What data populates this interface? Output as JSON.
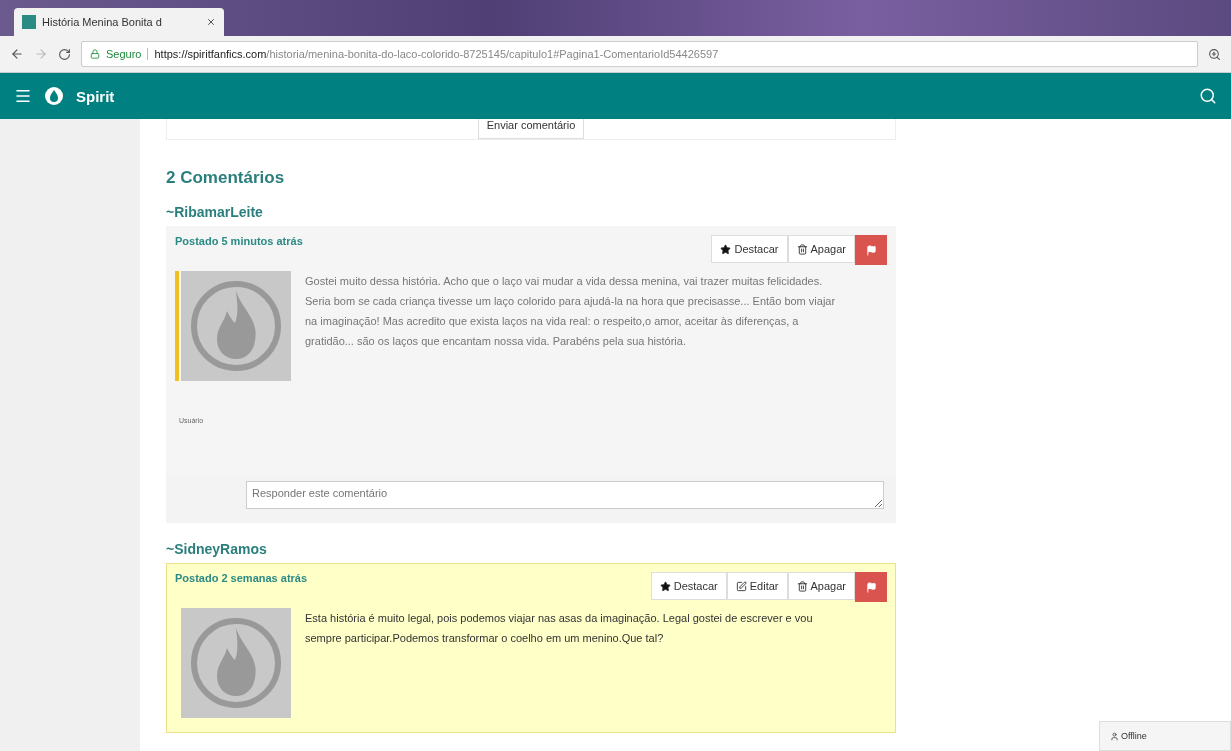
{
  "browser": {
    "tab_title": "História Menina Bonita d",
    "secure_label": "Seguro",
    "url_host": "https://spiritfanfics.com",
    "url_path": "/historia/menina-bonita-do-laco-colorido-8725145/capitulo1#Pagina1-ComentarioId54426597"
  },
  "navbar": {
    "brand": "Spirit"
  },
  "top_card": {
    "button": "Enviar comentário"
  },
  "comments_heading": "2 Comentários",
  "comments": [
    {
      "author": "~RibamarLeite",
      "posted": "Postado 5 minutos atrás",
      "highlighted": false,
      "marked": true,
      "buttons": [
        {
          "kind": "star",
          "label": "Destacar"
        },
        {
          "kind": "trash",
          "label": "Apagar"
        },
        {
          "kind": "flag"
        }
      ],
      "text": "Gostei muito dessa história. Acho que o laço vai mudar a vida dessa menina, vai trazer muitas felicidades. Seria bom se cada criança tivesse um laço colorido para ajudá-la na hora que precisasse... Então bom viajar na imaginação! Mas acredito que exista laços na vida real: o respeito,o amor, aceitar às diferenças, a gratidão... são os laços que encantam nossa vida. Parabéns pela sua história.",
      "role": "Usuário",
      "reply_placeholder": "Responder este comentário"
    },
    {
      "author": "~SidneyRamos",
      "posted": "Postado 2 semanas atrás",
      "highlighted": true,
      "marked": false,
      "buttons": [
        {
          "kind": "star",
          "label": "Destacar"
        },
        {
          "kind": "edit",
          "label": "Editar"
        },
        {
          "kind": "trash",
          "label": "Apagar"
        },
        {
          "kind": "flag"
        }
      ],
      "text": "Esta história é muito legal, pois podemos viajar nas asas da imaginação. Legal gostei de escrever e vou sempre participar.Podemos transformar o coelho em um menino.Que tal?"
    }
  ],
  "chat": {
    "status": "Offline"
  }
}
